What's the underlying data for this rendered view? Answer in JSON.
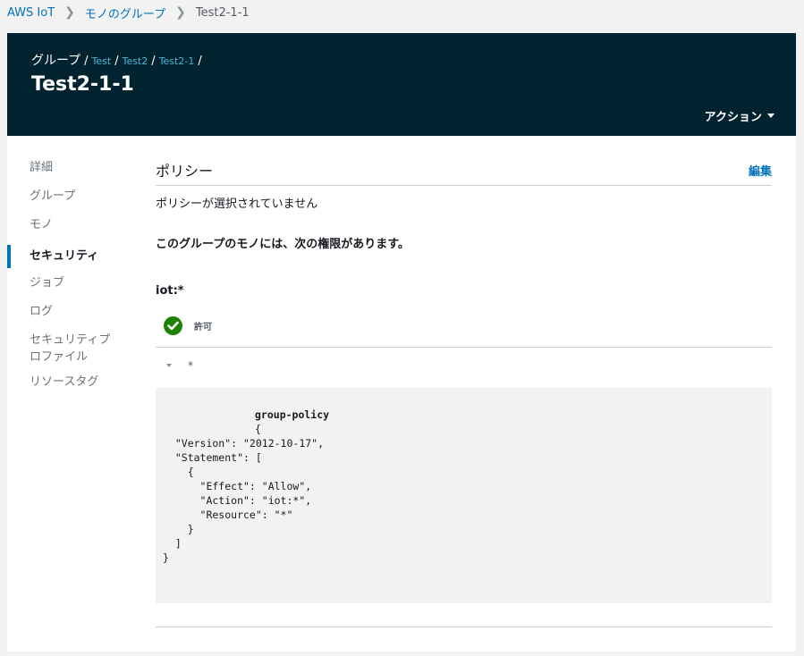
{
  "breadcrumb": {
    "items": [
      "AWS IoT",
      "モノのグループ"
    ],
    "current": "Test2-1-1"
  },
  "header": {
    "crumb_root": "グループ",
    "crumb_links": [
      "Test",
      "Test2",
      "Test2-1"
    ],
    "title": "Test2-1-1",
    "actions_label": "アクション"
  },
  "sidebar": {
    "items": [
      {
        "label": "詳細"
      },
      {
        "label": "グループ"
      },
      {
        "label": "モノ"
      },
      {
        "label": "セキュリティ",
        "active": true
      },
      {
        "label": "ジョブ"
      },
      {
        "label": "ログ"
      },
      {
        "label": "セキュリティプロファイル"
      },
      {
        "label": "リソースタグ"
      }
    ]
  },
  "policy": {
    "section_title": "ポリシー",
    "edit_label": "編集",
    "no_policy_text": "ポリシーが選択されていません",
    "permissions_heading": "このグループのモノには、次の権限があります。",
    "action_name": "iot:*",
    "effect_label": "許可",
    "resource": "*",
    "document_title": "group-policy",
    "document_lines": [
      "{",
      "  \"Version\": \"2012-10-17\",",
      "  \"Statement\": [",
      "    {",
      "      \"Effect\": \"Allow\",",
      "      \"Action\": \"iot:*\",",
      "      \"Resource\": \"*\"",
      "    }",
      "  ]",
      "}"
    ]
  },
  "colors": {
    "header_bg": "#012330",
    "link": "#0073bb",
    "header_link": "#44b9d6",
    "allow_green": "#1d8102",
    "code_bg": "#f2f2f2"
  }
}
